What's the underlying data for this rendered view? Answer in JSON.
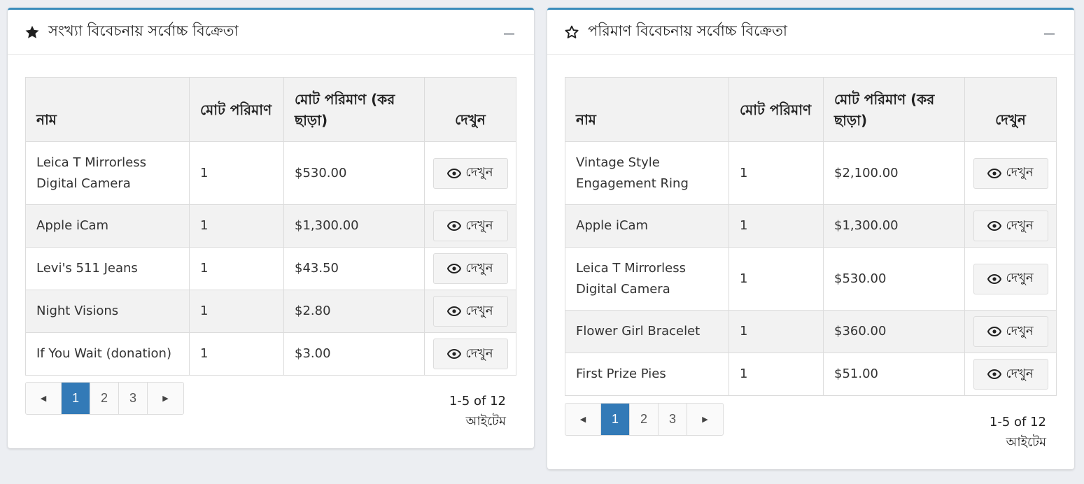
{
  "left_card": {
    "title": "সংখ্যা বিবেচনায় সর্বোচ্চ বিক্রেতা",
    "star_icon": "star-filled-icon",
    "headers": [
      "নাম",
      "মোট পরিমাণ",
      "মোট পরিমাণ (কর ছাড়া)",
      "দেখুন"
    ],
    "rows": [
      {
        "name": "Leica T Mirrorless Digital Camera",
        "qty": "1",
        "amount": "$530.00",
        "view": "দেখুন"
      },
      {
        "name": "Apple iCam",
        "qty": "1",
        "amount": "$1,300.00",
        "view": "দেখুন"
      },
      {
        "name": "Levi's 511 Jeans",
        "qty": "1",
        "amount": "$43.50",
        "view": "দেখুন"
      },
      {
        "name": "Night Visions",
        "qty": "1",
        "amount": "$2.80",
        "view": "দেখুন"
      },
      {
        "name": "If You Wait (donation)",
        "qty": "1",
        "amount": "$3.00",
        "view": "দেখুন"
      }
    ],
    "pagination": {
      "prev": "◀",
      "pages": [
        "1",
        "2",
        "3"
      ],
      "next": "▶",
      "active": "1"
    },
    "items_info": {
      "range": "1-5 of 12",
      "unit": "আইটেম"
    }
  },
  "right_card": {
    "title": "পরিমাণ বিবেচনায় সর্বোচ্চ বিক্রেতা",
    "star_icon": "star-outline-icon",
    "headers": [
      "নাম",
      "মোট পরিমাণ",
      "মোট পরিমাণ (কর ছাড়া)",
      "দেখুন"
    ],
    "rows": [
      {
        "name": "Vintage Style Engagement Ring",
        "qty": "1",
        "amount": "$2,100.00",
        "view": "দেখুন"
      },
      {
        "name": "Apple iCam",
        "qty": "1",
        "amount": "$1,300.00",
        "view": "দেখুন"
      },
      {
        "name": "Leica T Mirrorless Digital Camera",
        "qty": "1",
        "amount": "$530.00",
        "view": "দেখুন"
      },
      {
        "name": "Flower Girl Bracelet",
        "qty": "1",
        "amount": "$360.00",
        "view": "দেখুন"
      },
      {
        "name": "First Prize Pies",
        "qty": "1",
        "amount": "$51.00",
        "view": "দেখুন"
      }
    ],
    "pagination": {
      "prev": "◀",
      "pages": [
        "1",
        "2",
        "3"
      ],
      "next": "▶",
      "active": "1"
    },
    "items_info": {
      "range": "1-5 of 12",
      "unit": "আইটেম"
    }
  },
  "colors": {
    "accent": "#3c8dbc",
    "active_page": "#337ab7",
    "background": "#eceef2",
    "zebra": "#f2f2f2"
  }
}
